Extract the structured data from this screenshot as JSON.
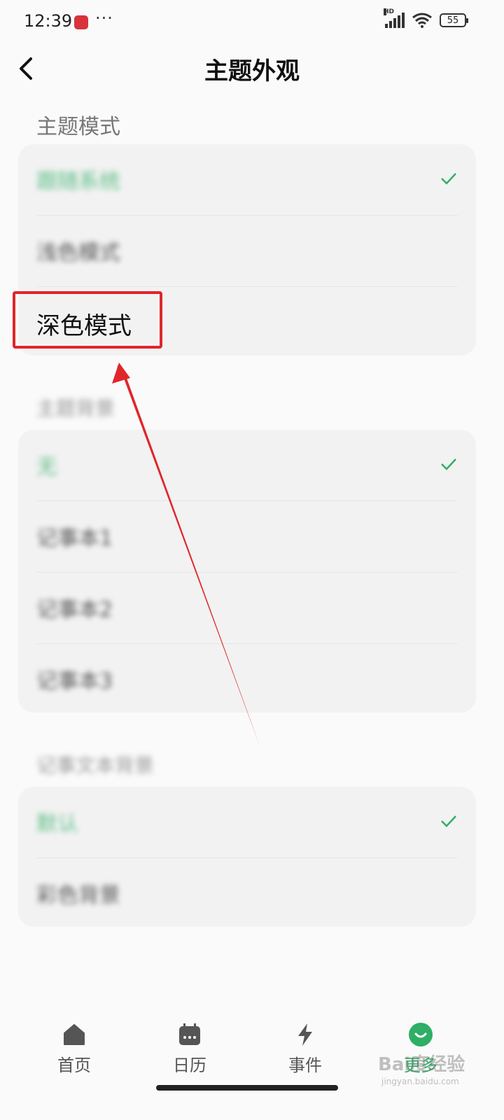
{
  "status": {
    "time": "12:39",
    "dots": "···",
    "battery": "55",
    "hd": "HD"
  },
  "header": {
    "title": "主题外观"
  },
  "section_theme_mode": {
    "label": "主题模式",
    "items": [
      {
        "label": "跟随系统",
        "checked": true
      },
      {
        "label": "浅色模式",
        "checked": false
      },
      {
        "label": "深色模式",
        "checked": false
      }
    ]
  },
  "section_theme_bg": {
    "label": "主题背景",
    "items": [
      {
        "label": "无",
        "checked": true
      },
      {
        "label": "记事本1",
        "checked": false
      },
      {
        "label": "记事本2",
        "checked": false
      },
      {
        "label": "记事本3",
        "checked": false
      }
    ]
  },
  "section_font": {
    "label": "记事文本背景",
    "items": [
      {
        "label": "默认",
        "checked": true
      },
      {
        "label": "彩色背景",
        "checked": false
      }
    ]
  },
  "tabs": [
    {
      "label": "首页",
      "active": false
    },
    {
      "label": "日历",
      "active": false
    },
    {
      "label": "事件",
      "active": false
    },
    {
      "label": "更多",
      "active": true
    }
  ],
  "watermark": {
    "brand": "Bai度经验",
    "url": "jingyan.baidu.com"
  },
  "colors": {
    "accent": "#2fae65",
    "annotation": "#e0262b"
  }
}
